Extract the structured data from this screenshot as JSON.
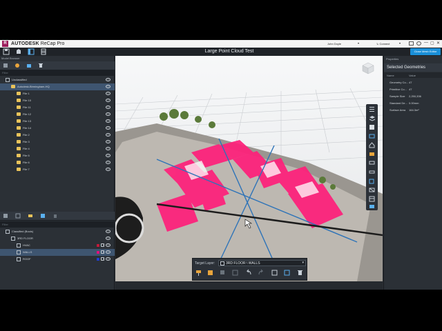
{
  "app": {
    "logo_letter": "R",
    "brand": "AUTODESK",
    "product": "ReCap Pro",
    "user": "John Doyle",
    "connect": "Connect",
    "caret": "▾",
    "window_controls": [
      "—",
      "▢",
      "✕"
    ]
  },
  "document": {
    "title": "Large Point Cloud Test",
    "close_button": "Close Mesh Editor"
  },
  "model_browser": {
    "title": "Model Browser",
    "filter_placeholder": "Filter",
    "items": [
      {
        "label": "Unclassified",
        "level": 0,
        "kind": "cube"
      },
      {
        "label": "Autodesk-Birmingham-HQ",
        "level": 1,
        "kind": "folder",
        "selected": true
      },
      {
        "label": "File 1",
        "level": 2,
        "kind": "folder"
      },
      {
        "label": "File 10",
        "level": 2,
        "kind": "folder"
      },
      {
        "label": "File 11",
        "level": 2,
        "kind": "folder"
      },
      {
        "label": "File 12",
        "level": 2,
        "kind": "folder"
      },
      {
        "label": "File 13",
        "level": 2,
        "kind": "folder"
      },
      {
        "label": "File 14",
        "level": 2,
        "kind": "folder"
      },
      {
        "label": "File 2",
        "level": 2,
        "kind": "folder"
      },
      {
        "label": "File 3",
        "level": 2,
        "kind": "folder"
      },
      {
        "label": "File 4",
        "level": 2,
        "kind": "folder"
      },
      {
        "label": "File 5",
        "level": 2,
        "kind": "folder"
      },
      {
        "label": "File 6",
        "level": 2,
        "kind": "folder"
      },
      {
        "label": "File 7",
        "level": 2,
        "kind": "folder"
      }
    ]
  },
  "classified": {
    "filter_placeholder": "Filter",
    "items": [
      {
        "label": "Classified (Bools)",
        "level": 0,
        "swatch": null
      },
      {
        "label": "3RD FLOOR",
        "level": 1,
        "swatch": null
      },
      {
        "label": "HVAC",
        "level": 2,
        "swatch": "#c21a3a"
      },
      {
        "label": "WALLS",
        "level": 2,
        "swatch": "#e0107a",
        "selected": true
      },
      {
        "label": "ROOF",
        "level": 2,
        "swatch": "#1f3fd0"
      }
    ]
  },
  "properties": {
    "title": "Properties",
    "heading": "Selected Geometries",
    "col_name": "Name",
    "col_value": "Value",
    "rows": [
      {
        "name": "Geometry Co...",
        "value": "47"
      },
      {
        "name": "Primitive Co...",
        "value": "47"
      },
      {
        "name": "Sample Size",
        "value": "2,250,336"
      },
      {
        "name": "Standard De...",
        "value": "0.00mm"
      },
      {
        "name": "Surface Area",
        "value": "164.3m²"
      }
    ]
  },
  "layer_bar": {
    "label": "Target Layer:",
    "value": "3RD FLOOR \\ WALLS",
    "caret": "▾"
  },
  "colors": {
    "accent": "#1a8fd8",
    "highlight": "#ff1f7a",
    "selection": "#3e5570"
  }
}
